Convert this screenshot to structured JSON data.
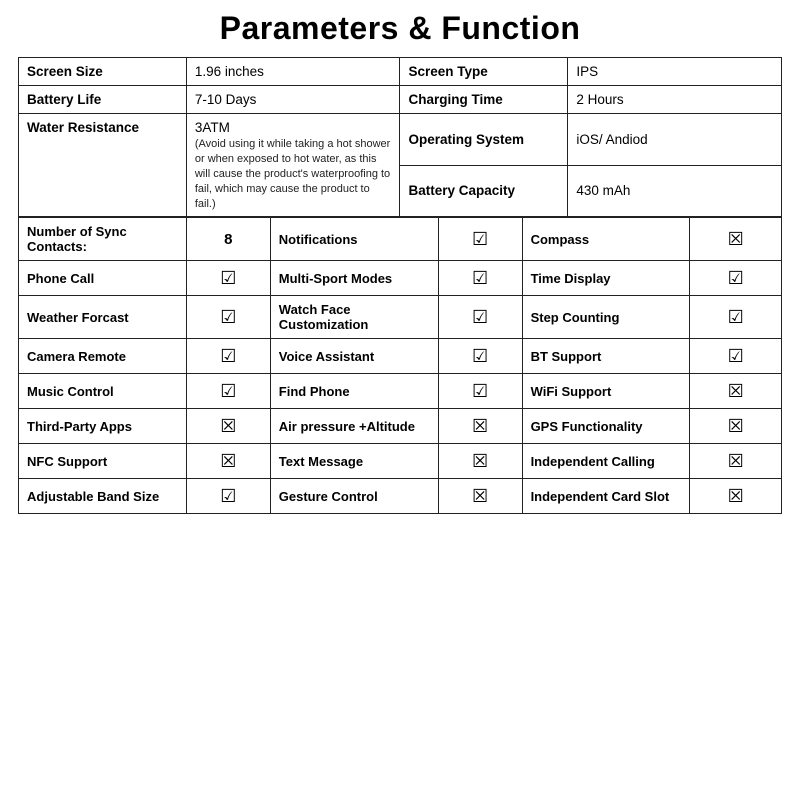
{
  "title": "Parameters & Function",
  "specs": {
    "screen_size_label": "Screen Size",
    "screen_size_value": "1.96 inches",
    "screen_type_label": "Screen Type",
    "screen_type_value": "IPS",
    "battery_life_label": "Battery Life",
    "battery_life_value": "7-10 Days",
    "charging_time_label": "Charging Time",
    "charging_time_value": "2 Hours",
    "water_resistance_label": "Water Resistance",
    "water_resistance_value": "3ATM",
    "water_note": "(Avoid using it while taking a hot shower or when exposed to hot water, as this will cause the product's waterproofing to fail, which may cause the product to fail.)",
    "os_label": "Operating System",
    "os_value": "iOS/ Andiod",
    "battery_capacity_label": "Battery Capacity",
    "battery_capacity_value": "430 mAh"
  },
  "features": [
    {
      "col1_label": "Number of Sync Contacts:",
      "col1_value": "8",
      "col1_is_number": true,
      "col2_label": "Notifications",
      "col2_check": true,
      "col3_label": "Compass",
      "col3_check": false
    },
    {
      "col1_label": "Phone Call",
      "col1_check": true,
      "col2_label": "Multi-Sport Modes",
      "col2_check": true,
      "col3_label": "Time Display",
      "col3_check": true
    },
    {
      "col1_label": "Weather Forcast",
      "col1_check": true,
      "col2_label": "Watch Face Customization",
      "col2_check": true,
      "col3_label": "Step Counting",
      "col3_check": true
    },
    {
      "col1_label": "Camera Remote",
      "col1_check": true,
      "col2_label": "Voice Assistant",
      "col2_check": true,
      "col3_label": "BT Support",
      "col3_check": true
    },
    {
      "col1_label": "Music Control",
      "col1_check": true,
      "col2_label": "Find Phone",
      "col2_check": true,
      "col3_label": "WiFi Support",
      "col3_check": false
    },
    {
      "col1_label": "Third-Party Apps",
      "col1_check": false,
      "col2_label": "Air pressure +Altitude",
      "col2_check": false,
      "col3_label": "GPS Functionality",
      "col3_check": false
    },
    {
      "col1_label": "NFC Support",
      "col1_check": false,
      "col2_label": "Text Message",
      "col2_check": false,
      "col3_label": "Independent Calling",
      "col3_check": false
    },
    {
      "col1_label": "Adjustable Band Size",
      "col1_check": true,
      "col2_label": "Gesture Control",
      "col2_check": false,
      "col3_label": "Independent Card Slot",
      "col3_check": false
    }
  ],
  "check_true": "☑",
  "check_false": "☒"
}
